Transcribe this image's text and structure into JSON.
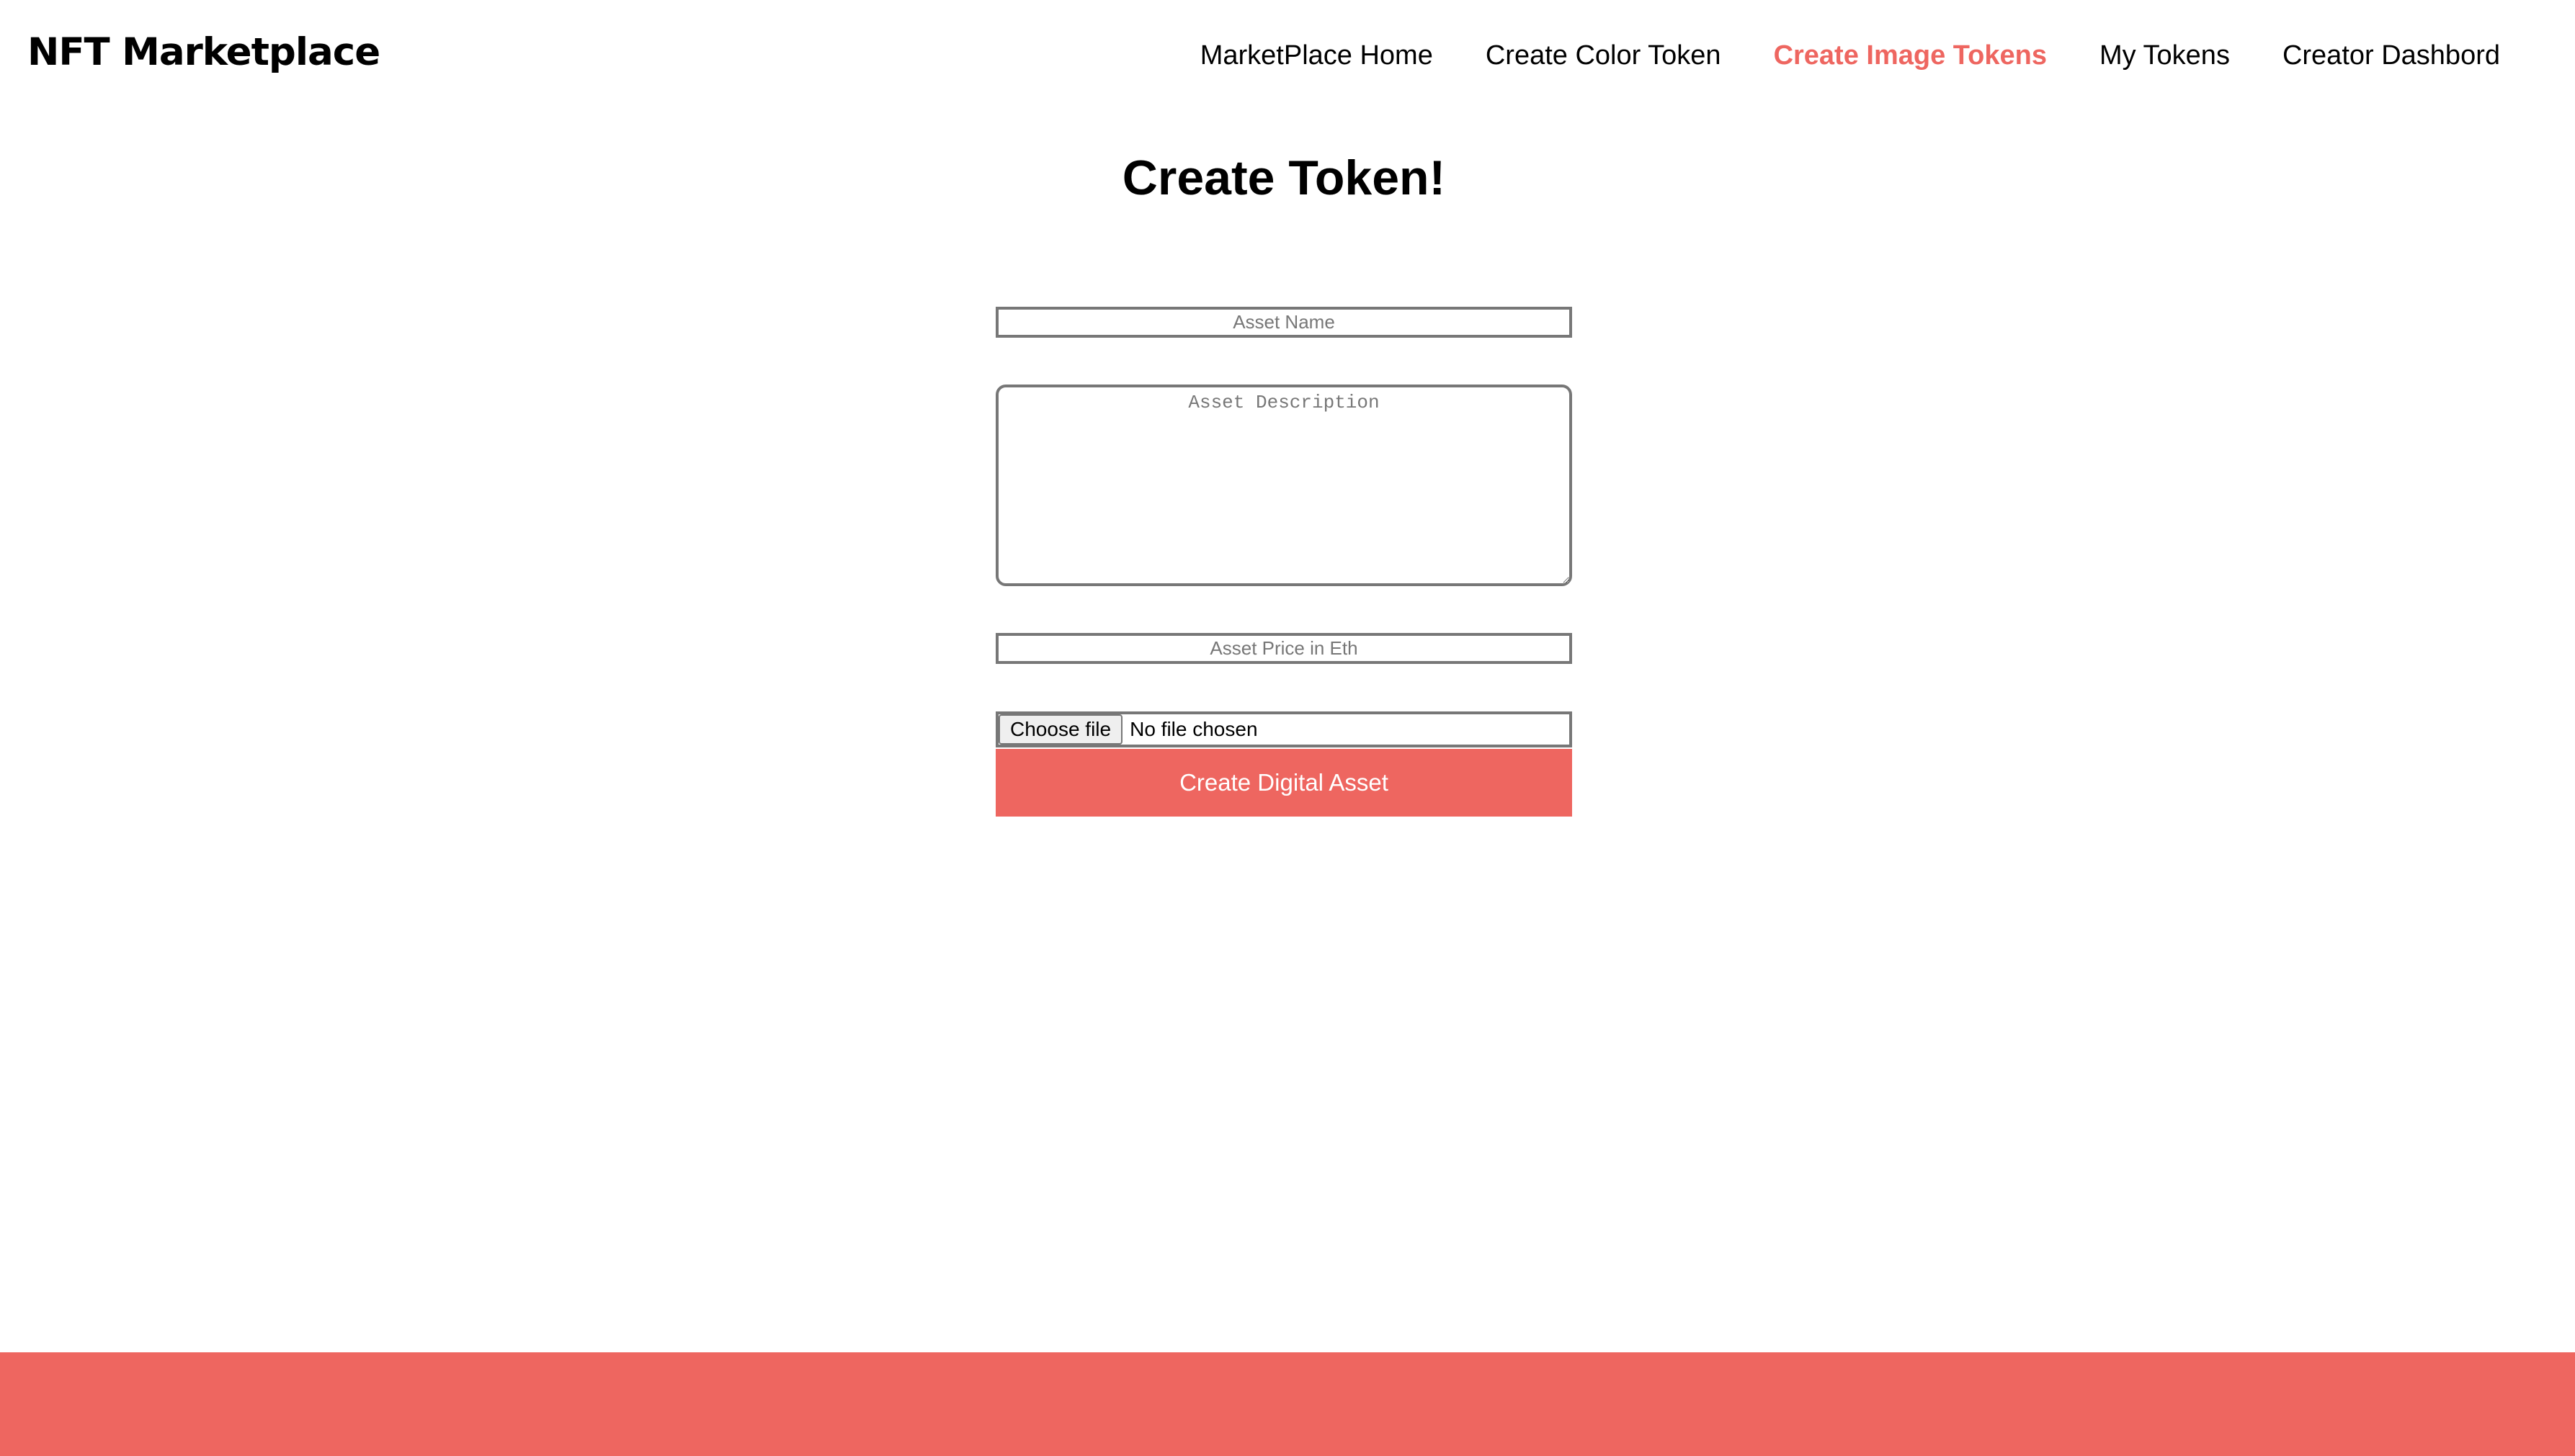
{
  "brand": {
    "title": "NFT Marketplace"
  },
  "nav": {
    "items": [
      {
        "label": "MarketPlace Home",
        "active": false
      },
      {
        "label": "Create Color Token",
        "active": false
      },
      {
        "label": "Create Image Tokens",
        "active": true
      },
      {
        "label": "My Tokens",
        "active": false
      },
      {
        "label": "Creator Dashbord",
        "active": false
      }
    ]
  },
  "page": {
    "title": "Create Token!"
  },
  "form": {
    "name_placeholder": "Asset Name",
    "name_value": "",
    "description_placeholder": "Asset Description",
    "description_value": "",
    "price_placeholder": "Asset Price in Eth",
    "price_value": "",
    "file_button_label": "Choose file",
    "file_status": "No file chosen",
    "submit_label": "Create Digital Asset"
  },
  "colors": {
    "accent": "#ee6660",
    "text": "#000000",
    "border": "#777777"
  }
}
